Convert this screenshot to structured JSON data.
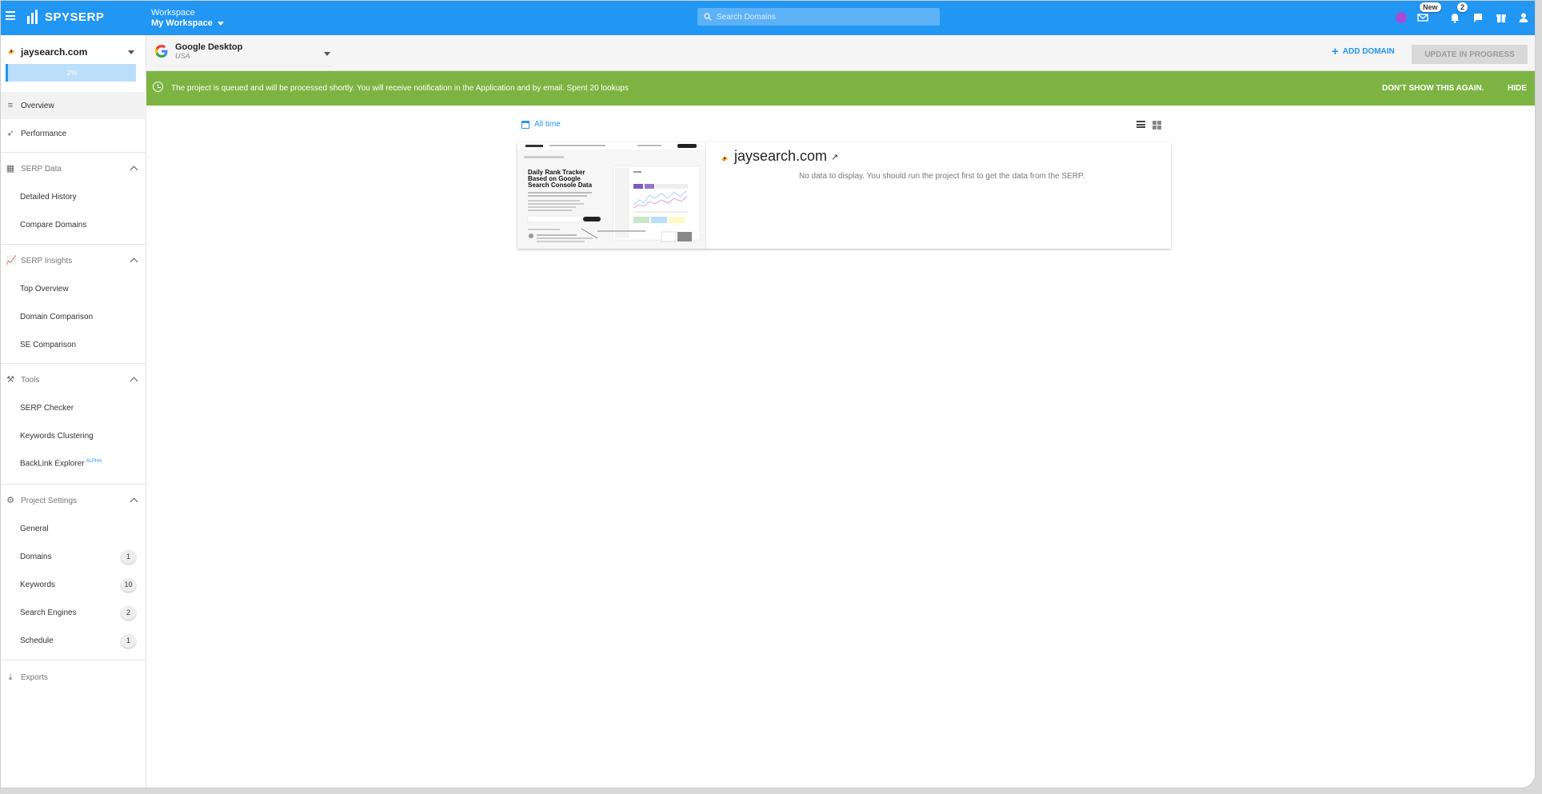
{
  "topbar": {
    "logo": "SPYSERP",
    "workspace_label": "Workspace",
    "workspace_value": "My Workspace",
    "search_placeholder": "Search Domains",
    "new_badge": "New",
    "notif_count": "2"
  },
  "sidebar": {
    "project_name": "jaysearch.com",
    "progress": "2%",
    "items": {
      "overview": "Overview",
      "performance": "Performance",
      "serp_data": "SERP Data",
      "detailed_history": "Detailed History",
      "compare_domains": "Compare Domains",
      "serp_insights": "SERP Insights",
      "top_overview": "Top Overview",
      "domain_comparison": "Domain Comparison",
      "se_comparison": "SE Comparison",
      "tools": "Tools",
      "serp_checker": "SERP Checker",
      "keywords_clustering": "Keywords Clustering",
      "backlink_explorer": "BackLink Explorer",
      "alpha": "ALPHA",
      "project_settings": "Project Settings",
      "general": "General",
      "domains": "Domains",
      "keywords": "Keywords",
      "search_engines": "Search Engines",
      "schedule": "Schedule",
      "exports": "Exports"
    },
    "counts": {
      "domains": "1",
      "keywords": "10",
      "search_engines": "2",
      "schedule": "1"
    }
  },
  "subbar": {
    "engine_name": "Google Desktop",
    "engine_country": "USA",
    "add_domain": "ADD DOMAIN",
    "update_button": "UPDATE IN PROGRESS"
  },
  "banner": {
    "message": "The project is queued and will be processed shortly. You will receive notification in the Application and by email. Spent 20 lookups",
    "dont_show": "DON'T SHOW THIS AGAIN.",
    "hide": "HIDE"
  },
  "main": {
    "period": "All time",
    "domain": "jaysearch.com",
    "no_data": "No data to display. You should run the project first to get the data from the SERP.",
    "thumbnail": {
      "headline1": "Daily Rank Tracker",
      "headline2": "Based on Google",
      "headline3": "Search Console Data"
    }
  },
  "colors": {
    "brand": "#2196f3",
    "banner": "#7cb342",
    "progress_bg": "#bbdefb"
  }
}
